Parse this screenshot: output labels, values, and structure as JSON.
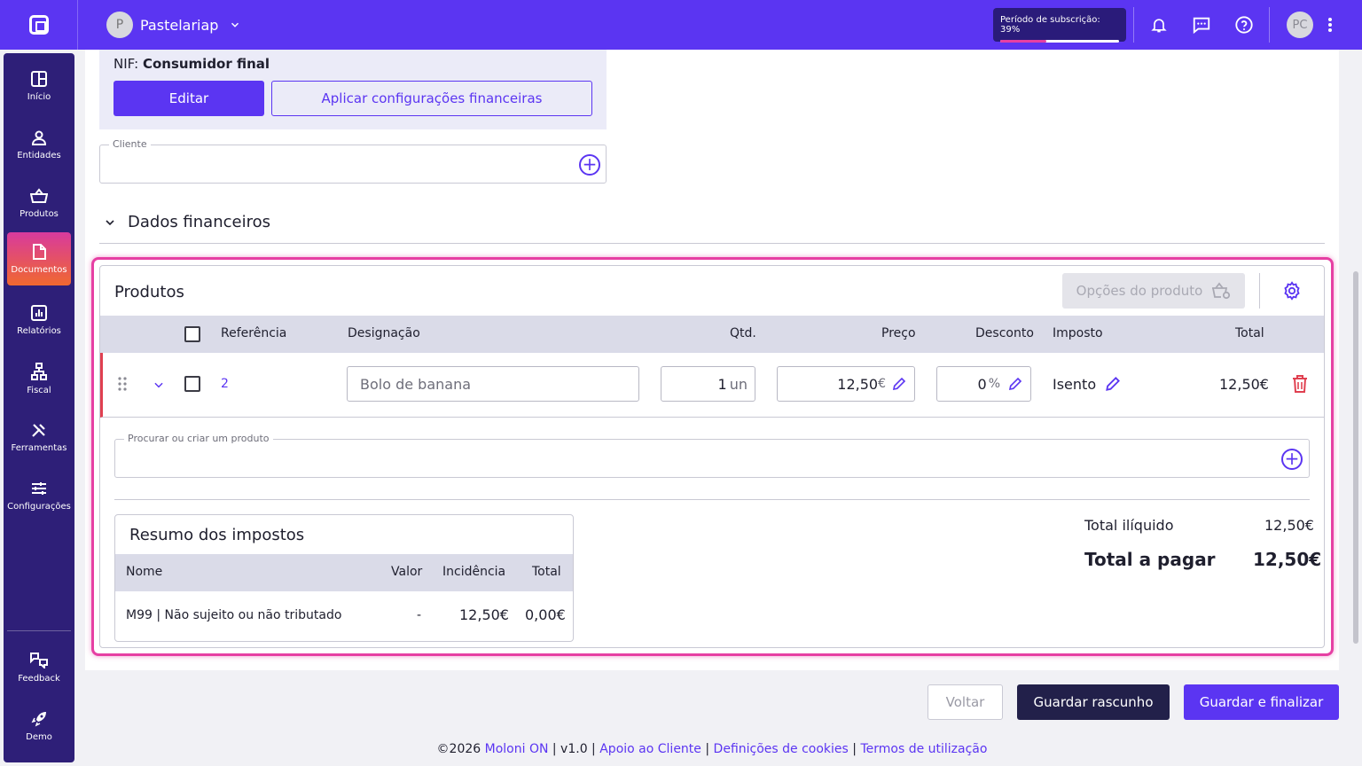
{
  "colors": {
    "primary": "#5b35f2",
    "sidebar": "#2e1f78",
    "highlight": "#e63fa3",
    "danger": "#e04050"
  },
  "topbar": {
    "company_initial": "P",
    "company_name": "Pastelariap",
    "subscription_label": "Período de subscrição: 39%",
    "subscription_progress": 0.39,
    "user_initials": "PC",
    "icons": [
      "bell-icon",
      "chat-icon",
      "help-icon",
      "more-vert-icon"
    ]
  },
  "sidebar": {
    "items": [
      {
        "label": "Início",
        "icon": "grid-icon"
      },
      {
        "label": "Entidades",
        "icon": "user-icon"
      },
      {
        "label": "Produtos",
        "icon": "basket-icon"
      },
      {
        "label": "Documentos",
        "icon": "document-icon",
        "active": true
      },
      {
        "label": "Relatórios",
        "icon": "chart-icon"
      },
      {
        "label": "Fiscal",
        "icon": "hierarchy-icon"
      },
      {
        "label": "Ferramentas",
        "icon": "tools-icon"
      },
      {
        "label": "Configurações",
        "icon": "sliders-icon"
      },
      {
        "label": "Feedback",
        "icon": "feedback-icon"
      },
      {
        "label": "Demo",
        "icon": "rocket-icon"
      }
    ]
  },
  "client": {
    "nif_label": "NIF:",
    "nif_value": "Consumidor final",
    "edit_label": "Editar",
    "apply_label": "Aplicar configurações financeiras",
    "field_legend": "Cliente",
    "field_value": ""
  },
  "financial": {
    "title": "Dados financeiros"
  },
  "products": {
    "title": "Produtos",
    "options_label": "Opções do produto",
    "columns": {
      "reference": "Referência",
      "designation": "Designação",
      "qty": "Qtd.",
      "price": "Preço",
      "discount": "Desconto",
      "tax": "Imposto",
      "total": "Total"
    },
    "rows": [
      {
        "reference": "2",
        "designation": "Bolo de banana",
        "qty": "1",
        "qty_unit": "un",
        "price": "12,50",
        "price_unit": "€",
        "discount": "0",
        "discount_unit": "%",
        "tax": "Isento",
        "total": "12,50€"
      }
    ],
    "search_legend": "Procurar ou criar um produto",
    "search_value": ""
  },
  "tax_summary": {
    "title": "Resumo dos impostos",
    "columns": {
      "name": "Nome",
      "value": "Valor",
      "incidence": "Incidência",
      "total": "Total"
    },
    "rows": [
      {
        "name": "M99 | Não sujeito ou não tributado",
        "value": "-",
        "incidence": "12,50€",
        "total": "0,00€"
      }
    ]
  },
  "totals": {
    "net_label": "Total ilíquido",
    "net_value": "12,50€",
    "pay_label": "Total a pagar",
    "pay_value": "12,50€"
  },
  "actions": {
    "back_label": "Voltar",
    "draft_label": "Guardar rascunho",
    "finalize_label": "Guardar e finalizar"
  },
  "footer": {
    "copyright": "©2026 ",
    "brand": "Moloni ON",
    "sep1": " | v1.0 | ",
    "support": "Apoio ao Cliente",
    "sep2": " | ",
    "cookies": "Definições de cookies",
    "sep3": " | ",
    "terms": "Termos de utilização"
  }
}
